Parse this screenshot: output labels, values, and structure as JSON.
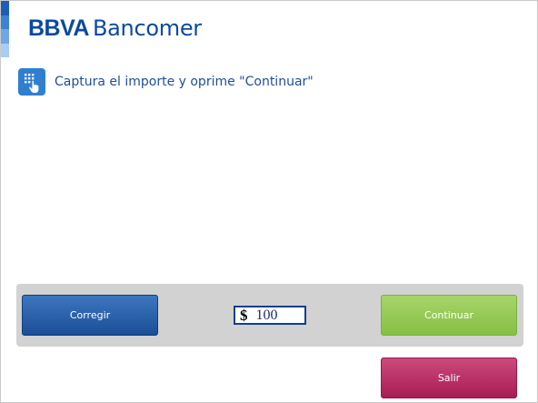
{
  "header": {
    "logo_brand": "BBVA",
    "logo_name": "Bancomer",
    "brand_color": "#0b4a9e",
    "stripe_colors": [
      "#1a5fb4",
      "#3b82d6",
      "#6fa8e6",
      "#a9cdf2"
    ]
  },
  "instruction": {
    "icon": "keypad-hand-icon",
    "text": "Captura el importe y oprime \"Continuar\""
  },
  "amount": {
    "currency_symbol": "$",
    "value": "100"
  },
  "buttons": {
    "corregir_label": "Corregir",
    "continuar_label": "Continuar",
    "salir_label": "Salir"
  },
  "colors": {
    "corregir": "#1f5aa6",
    "continuar": "#94c857",
    "salir": "#b52a62",
    "action_bar": "#d2d2d2"
  }
}
